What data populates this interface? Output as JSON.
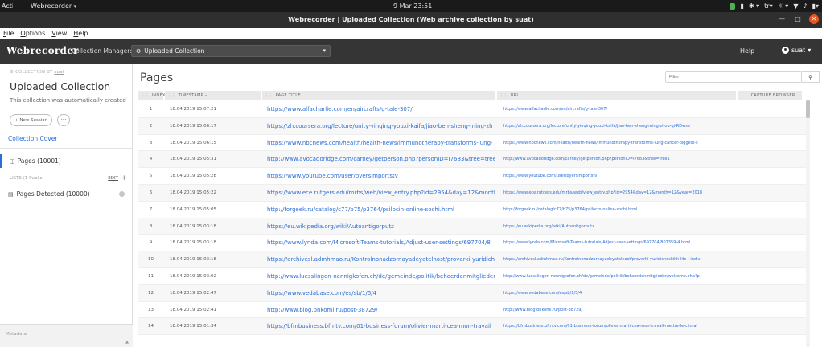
{
  "system_bar": {
    "activities": "Activities",
    "app_name": "Webrecorder",
    "clock": "9 Mar  23:51",
    "keyboard": "tr"
  },
  "window": {
    "title": "Webrecorder | Uploaded Collection (Web archive collection by suat)"
  },
  "menu": {
    "items": [
      "File",
      "Options",
      "View",
      "Help"
    ]
  },
  "navbar": {
    "brand": "Webrecorder",
    "collection_manager_label": "Collection Manager:",
    "collection_selected": "Uploaded Collection",
    "help": "Help",
    "user": "suat"
  },
  "sidebar": {
    "collection_by": "COLLECTION BY",
    "collection_owner": "suat",
    "collection_title": "Uploaded Collection",
    "collection_desc": "This collection was automatically created",
    "new_session": "+ New Session",
    "more": "···",
    "collection_cover": "Collection Cover",
    "pages_label": "Pages (10001)",
    "lists_header": "LISTS (1 Public)",
    "edit": "EDIT",
    "add": "+",
    "list_item": "Pages Detected (10000)",
    "metadata": "Metadata"
  },
  "main": {
    "title": "Pages",
    "filter_placeholder": "Filter",
    "columns": {
      "index": "INDEX",
      "timestamp": "TIMESTAMP",
      "timestamp_sort": "–",
      "page_title": "PAGE TITLE",
      "url": "URL",
      "capture_browser": "CAPTURE BROWSER"
    },
    "rows": [
      {
        "index": "1",
        "timestamp": "18.04.2019 15:07:21",
        "title": "https://www.alfacharlie.com/en/aircrafts/g-tale-307/",
        "url": "https://www.alfacharlie.com/en/aircrafts/g-tale-307/"
      },
      {
        "index": "2",
        "timestamp": "18.04.2019 15:06:17",
        "title": "https://zh.coursera.org/lecture/unity-yinqing-youxi-kaifa/jiao-ben-sheng-ming-zh",
        "url": "https://zh.coursera.org/lecture/unity-yinqing-youxi-kaifa/jiao-ben-sheng-ming-zhou-qi-RDwse"
      },
      {
        "index": "3",
        "timestamp": "18.04.2019 15:06:15",
        "title": "https://www.nbcnews.com/health/health-news/immunotherapy-transforms-lung-",
        "url": "https://www.nbcnews.com/health/health-news/immunotherapy-transforms-lung-cancer-biggest-c"
      },
      {
        "index": "4",
        "timestamp": "18.04.2019 15:05:31",
        "title": "http://www.avocadoridge.com/carney/getperson.php?personID=I7683&tree=tree",
        "url": "http://www.avocadoridge.com/carney/getperson.php?personID=I7683&tree=tree1"
      },
      {
        "index": "5",
        "timestamp": "18.04.2019 15:05:28",
        "title": "https://www.youtube.com/user/byersimportstv",
        "url": "https://www.youtube.com/user/byersimportstv"
      },
      {
        "index": "6",
        "timestamp": "18.04.2019 15:05:22",
        "title": "https://www.ece.rutgers.edu/mrbs/web/view_entry.php?id=2954&day=12&month",
        "url": "https://www.ece.rutgers.edu/mrbs/web/view_entry.php?id=2954&day=12&month=12&year=2018"
      },
      {
        "index": "7",
        "timestamp": "18.04.2019 15:05:05",
        "title": "http://forgeek.ru/catalog/c77/b75/p3764/psilocin-online-sochi.html",
        "url": "http://forgeek.ru/catalog/c77/b75/p3764/psilocin-online-sochi.html"
      },
      {
        "index": "8",
        "timestamp": "18.04.2019 15:03:18",
        "title": "https://eu.wikipedia.org/wiki/Autoantigorputz",
        "url": "https://eu.wikipedia.org/wiki/Autoantigorputz"
      },
      {
        "index": "9",
        "timestamp": "18.04.2019 15:03:18",
        "title": "https://www.lynda.com/Microsoft-Teams-tutorials/Adjust-user-settings/697704/8",
        "url": "https://www.lynda.com/Microsoft-Teams-tutorials/Adjust-user-settings/697704/807359-4.html"
      },
      {
        "index": "10",
        "timestamp": "18.04.2019 15:03:18",
        "title": "https://archivesl.admhmao.ru/Kontrolnonadzornayadeyatelnost/proverki-yuridich",
        "url": "https://archivesl.admhmao.ru/Kontrolnonadzornayadeyatelnost/proverki-yuridicheskikh-lits-i-indiv"
      },
      {
        "index": "11",
        "timestamp": "18.04.2019 15:03:02",
        "title": "http://www.luesslingen-nennigkofen.ch/de/gemeinde/politik/behoerdenmitglieder",
        "url": "http://www.luesslingen-nennigkofen.ch/de/gemeinde/politik/behoerdenmitglieder/welcome.php?p"
      },
      {
        "index": "12",
        "timestamp": "18.04.2019 15:02:47",
        "title": "https://www.vedabase.com/es/sb/1/5/4",
        "url": "https://www.vedabase.com/es/sb/1/5/4"
      },
      {
        "index": "13",
        "timestamp": "18.04.2019 15:02:41",
        "title": "http://www.blog.bnkomi.ru/post-38729/",
        "url": "http://www.blog.bnkomi.ru/post-38729/"
      },
      {
        "index": "14",
        "timestamp": "18.04.2019 15:01:34",
        "title": "https://bfmbusiness.bfmtv.com/01-business-forum/olivier-marti-cea-mon-travail",
        "url": "https://bfmbusiness.bfmtv.com/01-business-forum/olivier-marti-cea-mon-travail-mettre-le-climat"
      }
    ]
  },
  "colors": {
    "link": "#2c6ed5",
    "navbar": "#353535",
    "titlebar": "#2f2f2f",
    "close_button": "#e95420"
  }
}
